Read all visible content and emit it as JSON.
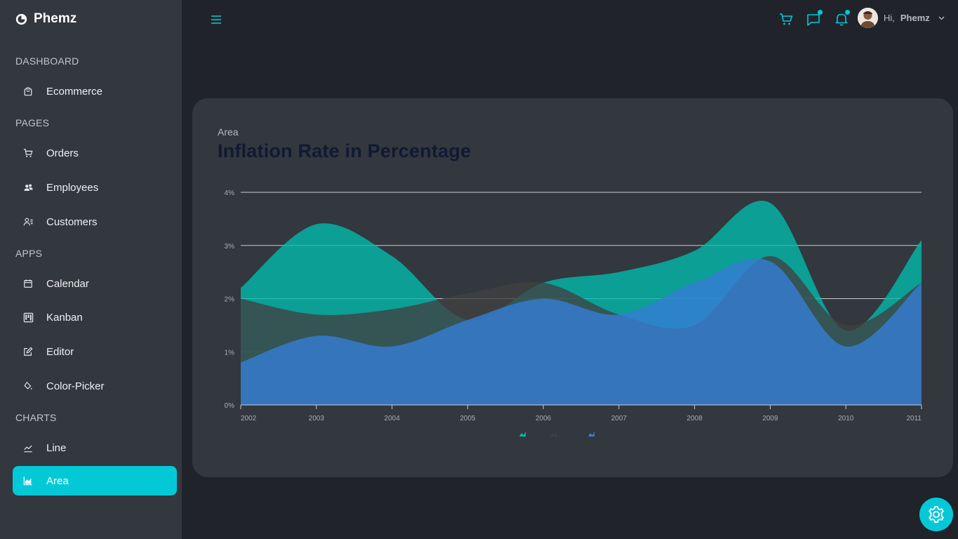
{
  "brand": {
    "name": "Phemz"
  },
  "sidebar": {
    "sections": [
      {
        "title": "DASHBOARD",
        "items": [
          {
            "label": "Ecommerce",
            "icon": "shopping-bag-icon"
          }
        ]
      },
      {
        "title": "PAGES",
        "items": [
          {
            "label": "Orders",
            "icon": "cart-icon"
          },
          {
            "label": "Employees",
            "icon": "people-icon"
          },
          {
            "label": "Customers",
            "icon": "user-list-icon"
          }
        ]
      },
      {
        "title": "APPS",
        "items": [
          {
            "label": "Calendar",
            "icon": "calendar-icon"
          },
          {
            "label": "Kanban",
            "icon": "kanban-icon"
          },
          {
            "label": "Editor",
            "icon": "edit-icon"
          },
          {
            "label": "Color-Picker",
            "icon": "paint-bucket-icon"
          }
        ]
      },
      {
        "title": "CHARTS",
        "items": [
          {
            "label": "Line",
            "icon": "line-chart-icon"
          },
          {
            "label": "Area",
            "icon": "area-chart-icon",
            "active": true
          }
        ]
      }
    ]
  },
  "header": {
    "greeting": "Hi,",
    "username": "Phemz",
    "icons": [
      "menu-icon",
      "cart-icon",
      "chat-icon",
      "bell-icon",
      "chevron-down-icon"
    ]
  },
  "card": {
    "category": "Area",
    "title": "Inflation Rate in Percentage"
  },
  "colors": {
    "accent": "#03c9d7",
    "series1": "#00bdae",
    "series2": "#404041",
    "series3": "#357cd2"
  },
  "chart_data": {
    "type": "area",
    "x": [
      2002,
      2003,
      2004,
      2005,
      2006,
      2007,
      2008,
      2009,
      2010,
      2011
    ],
    "ylim": [
      0,
      4
    ],
    "yticks": [
      "0%",
      "1%",
      "2%",
      "3%",
      "4%"
    ],
    "grid": true,
    "legend": "bottom",
    "series": [
      {
        "values": [
          2.2,
          3.4,
          2.8,
          1.6,
          2.3,
          2.5,
          2.9,
          3.8,
          1.4,
          3.1
        ]
      },
      {
        "values": [
          2.0,
          1.7,
          1.8,
          2.1,
          2.3,
          1.7,
          1.5,
          2.8,
          1.5,
          2.3
        ]
      },
      {
        "values": [
          0.8,
          1.3,
          1.1,
          1.6,
          2.0,
          1.7,
          2.3,
          2.7,
          1.1,
          2.3
        ]
      }
    ]
  }
}
